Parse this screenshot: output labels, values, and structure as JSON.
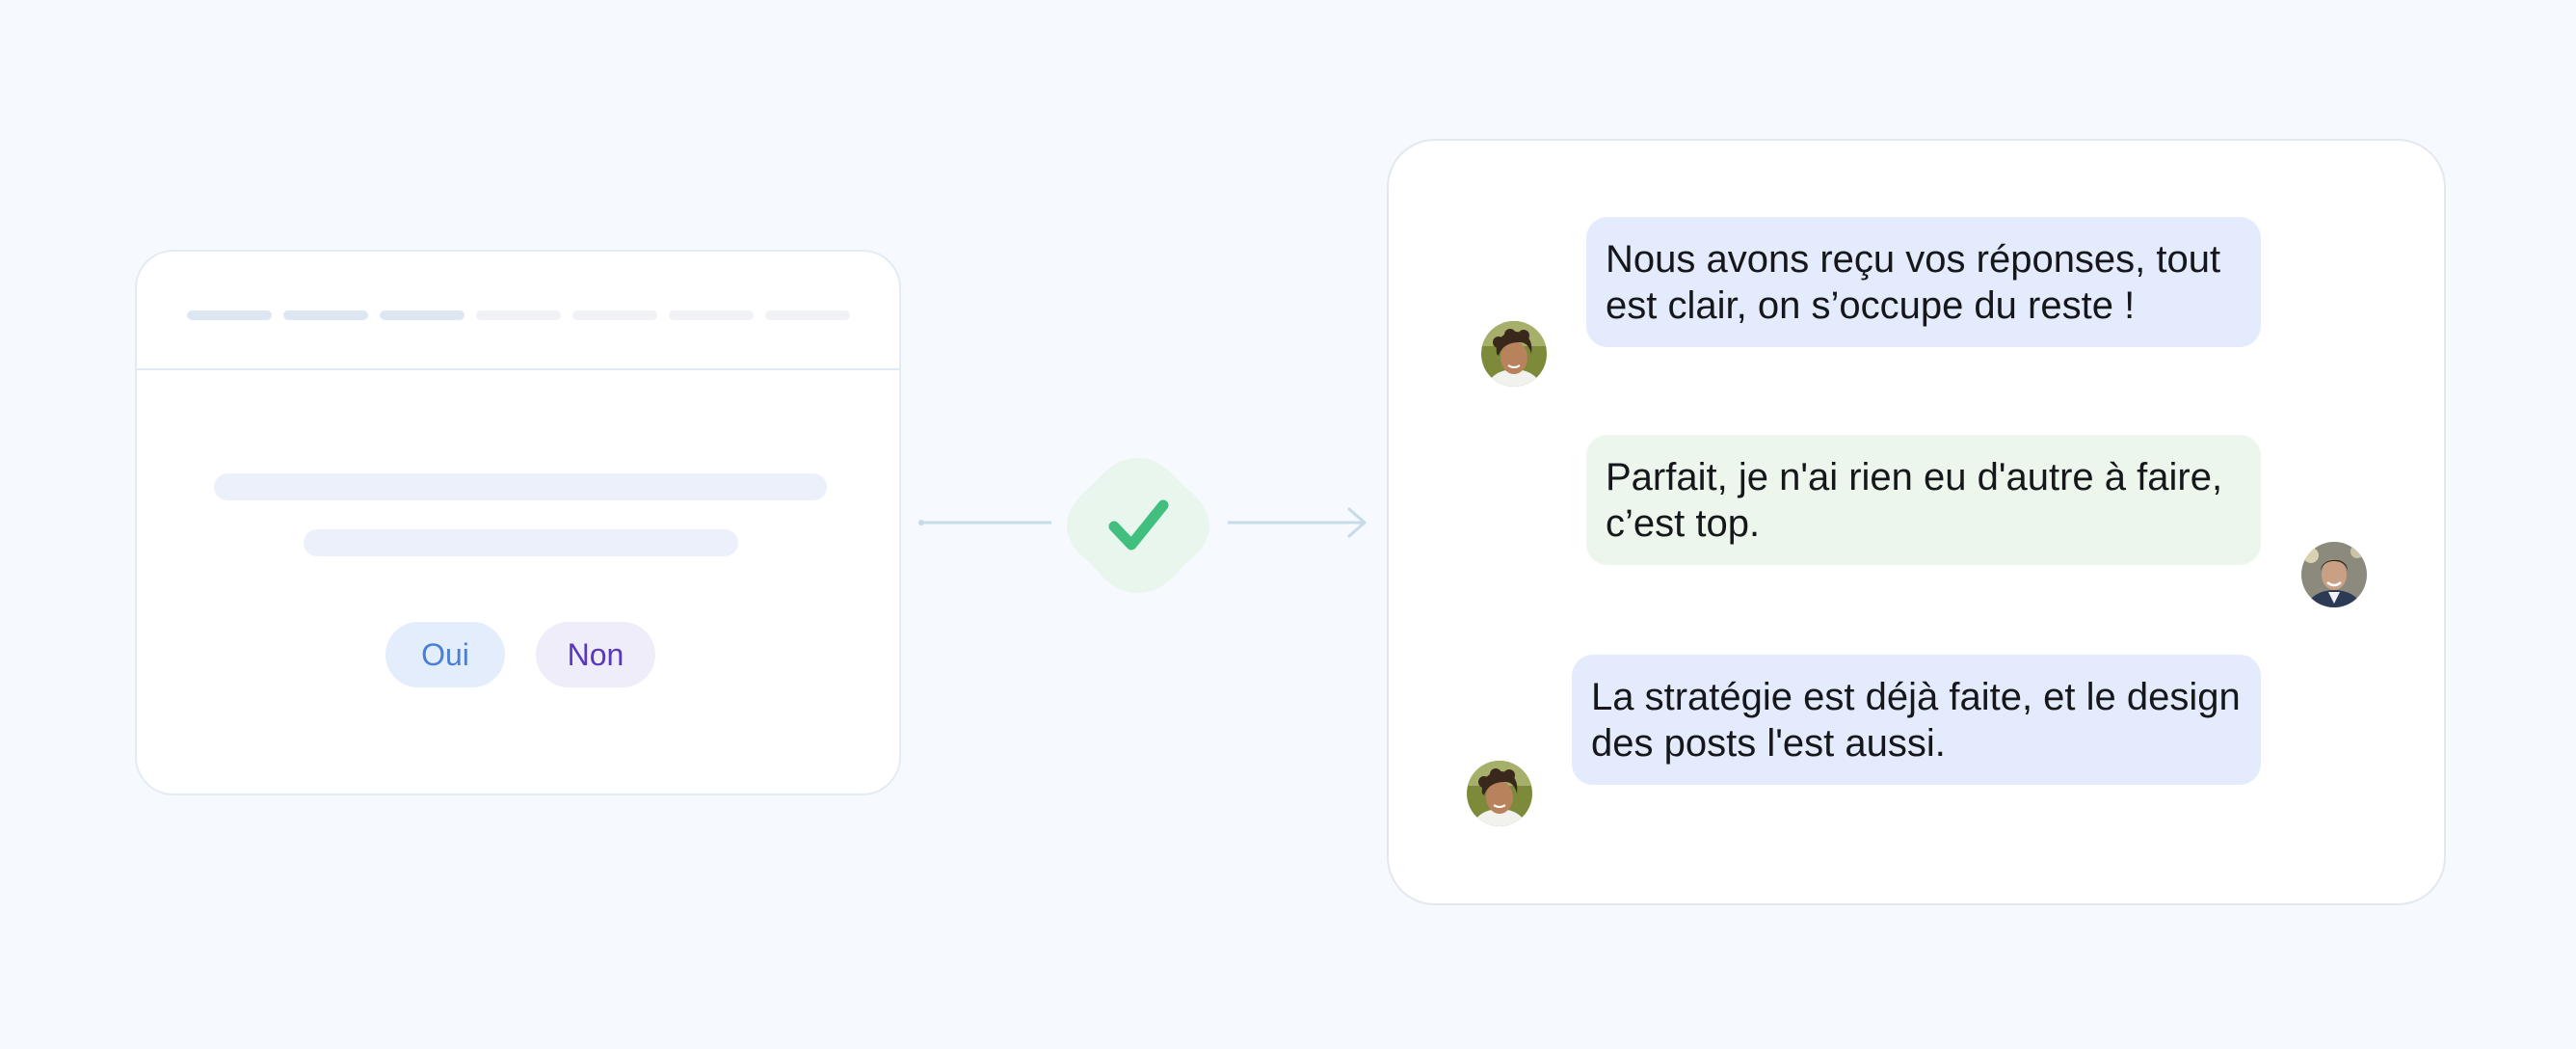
{
  "form": {
    "progress": {
      "total_steps": 7,
      "completed_steps": 3
    },
    "options": {
      "yes_label": "Oui",
      "no_label": "Non"
    }
  },
  "connector": {
    "icon": "check-icon",
    "badge_color": "#e8f6ee",
    "check_color": "#41bf7f"
  },
  "chat": {
    "messages": [
      {
        "sender": "agency",
        "avatar": "curly-hair-person-avatar",
        "text": "Nous avons reçu vos réponses, tout est clair, on s’occupe du reste !",
        "bubble_color": "#e3ebfc"
      },
      {
        "sender": "client",
        "avatar": "smiling-man-avatar",
        "text": "Parfait, je n'ai rien eu d'autre à faire, c’est top.",
        "bubble_color": "#ecf6ec"
      },
      {
        "sender": "agency",
        "avatar": "curly-hair-person-avatar",
        "text": "La stratégie est déjà faite, et le design des posts l'est aussi.",
        "bubble_color": "#e3ebfc"
      }
    ]
  }
}
